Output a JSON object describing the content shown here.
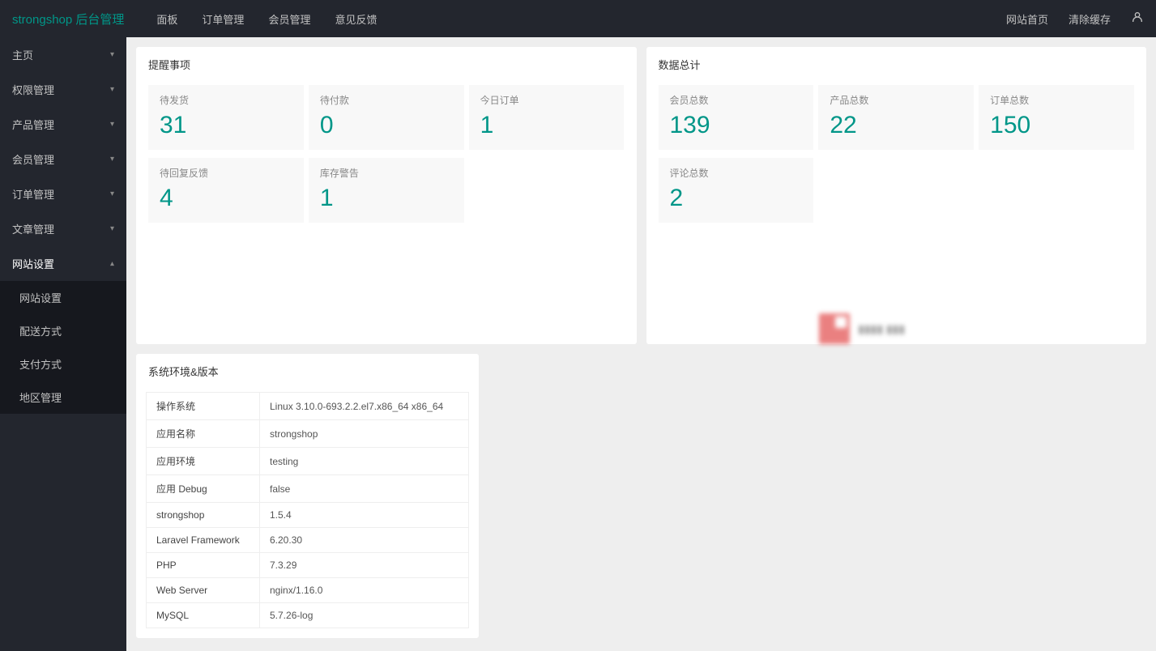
{
  "header": {
    "logo_main": "strongshop",
    "logo_sub": "后台管理",
    "nav": [
      "面板",
      "订单管理",
      "会员管理",
      "意见反馈"
    ],
    "right": [
      "网站首页",
      "清除缓存"
    ]
  },
  "sidebar": {
    "items": [
      {
        "label": "主页",
        "expanded": false
      },
      {
        "label": "权限管理",
        "expanded": false
      },
      {
        "label": "产品管理",
        "expanded": false
      },
      {
        "label": "会员管理",
        "expanded": false
      },
      {
        "label": "订单管理",
        "expanded": false
      },
      {
        "label": "文章管理",
        "expanded": false
      },
      {
        "label": "网站设置",
        "expanded": true,
        "children": [
          "网站设置",
          "配送方式",
          "支付方式",
          "地区管理"
        ]
      }
    ]
  },
  "reminders": {
    "title": "提醒事项",
    "items": [
      {
        "label": "待发货",
        "value": "31"
      },
      {
        "label": "待付款",
        "value": "0"
      },
      {
        "label": "今日订单",
        "value": "1"
      },
      {
        "label": "待回复反馈",
        "value": "4"
      },
      {
        "label": "库存警告",
        "value": "1"
      }
    ]
  },
  "totals": {
    "title": "数据总计",
    "items": [
      {
        "label": "会员总数",
        "value": "139"
      },
      {
        "label": "产品总数",
        "value": "22"
      },
      {
        "label": "订单总数",
        "value": "150"
      },
      {
        "label": "评论总数",
        "value": "2"
      }
    ]
  },
  "env": {
    "title": "系统环境&版本",
    "rows": [
      {
        "k": "操作系统",
        "v": "Linux 3.10.0-693.2.2.el7.x86_64 x86_64"
      },
      {
        "k": "应用名称",
        "v": "strongshop"
      },
      {
        "k": "应用环境",
        "v": "testing"
      },
      {
        "k": "应用 Debug",
        "v": "false"
      },
      {
        "k": "strongshop",
        "v": "1.5.4"
      },
      {
        "k": "Laravel Framework",
        "v": "6.20.30"
      },
      {
        "k": "PHP",
        "v": "7.3.29"
      },
      {
        "k": "Web Server",
        "v": "nginx/1.16.0"
      },
      {
        "k": "MySQL",
        "v": "5.7.26-log"
      }
    ]
  }
}
